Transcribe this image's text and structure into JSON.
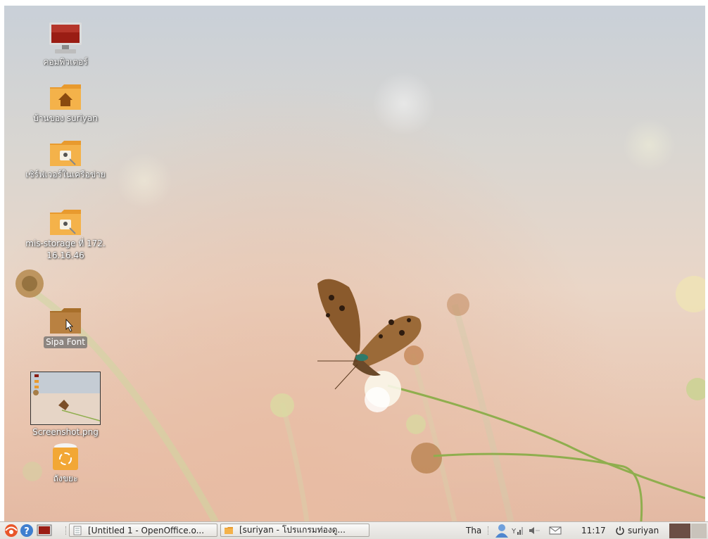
{
  "desktop": {
    "icons": [
      {
        "label": "คอมพิวเตอร์",
        "icon": "computer-icon"
      },
      {
        "label": "บ้านของ suriyan",
        "icon": "home-folder-icon"
      },
      {
        "label": "เซิร์ฟเวอร์ในเครือข่าย",
        "icon": "network-folder-icon"
      },
      {
        "label": "mis-storage ที่ 172.",
        "label2": "16.16.46",
        "icon": "network-share-icon"
      },
      {
        "label": "Sipa Font",
        "icon": "folder-icon"
      },
      {
        "label": "Screenshot.png",
        "icon": "image-thumbnail-icon"
      },
      {
        "label": "ถังขยะ",
        "icon": "trash-icon"
      }
    ]
  },
  "taskbar": {
    "tasks": [
      {
        "label": "[Untitled 1 - OpenOffice.o..."
      },
      {
        "label": "[suriyan - โปรแกรมท่องดู..."
      }
    ],
    "keyboard_layout": "Tha",
    "clock": "11:17",
    "user": "suriyan",
    "colors": {
      "workspace_active": "#6b4e45",
      "workspace_inactive": "#c9c3bb"
    }
  }
}
